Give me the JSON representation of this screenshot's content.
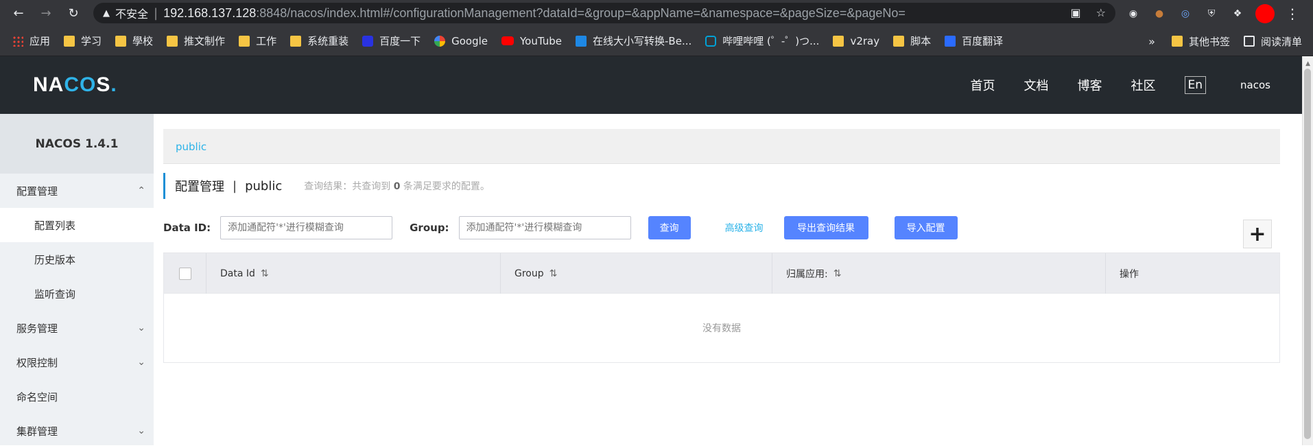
{
  "browser": {
    "security_label": "不安全",
    "url_host": "192.168.137.128",
    "url_path": ":8848/nacos/index.html#/configurationManagement?dataId=&group=&appName=&namespace=&pageSize=&pageNo=",
    "bookmarks": [
      {
        "label": "应用",
        "icon": "apps"
      },
      {
        "label": "学习",
        "icon": "folder"
      },
      {
        "label": "學校",
        "icon": "folder"
      },
      {
        "label": "推文制作",
        "icon": "folder"
      },
      {
        "label": "工作",
        "icon": "folder"
      },
      {
        "label": "系统重装",
        "icon": "folder"
      },
      {
        "label": "百度一下",
        "icon": "baidu"
      },
      {
        "label": "Google",
        "icon": "google"
      },
      {
        "label": "YouTube",
        "icon": "yt"
      },
      {
        "label": "在线大小写转换-Be...",
        "icon": "b"
      },
      {
        "label": "哔哩哔哩 (゜-゜)つ...",
        "icon": "bili"
      },
      {
        "label": "v2ray",
        "icon": "folder"
      },
      {
        "label": "脚本",
        "icon": "folder"
      },
      {
        "label": "百度翻译",
        "icon": "fanyi"
      }
    ],
    "other_bookmarks": "其他书签",
    "reading_list": "阅读清单",
    "more": "»"
  },
  "header": {
    "logo": "NACOS.",
    "nav": [
      "首页",
      "文档",
      "博客",
      "社区"
    ],
    "lang": "En",
    "user": "nacos"
  },
  "sidebar": {
    "title": "NACOS 1.4.1",
    "items": [
      {
        "label": "配置管理",
        "chevron": "up"
      },
      {
        "label": "配置列表",
        "sub": true,
        "active": true
      },
      {
        "label": "历史版本",
        "sub": true
      },
      {
        "label": "监听查询",
        "sub": true
      },
      {
        "label": "服务管理",
        "chevron": "down"
      },
      {
        "label": "权限控制",
        "chevron": "down"
      },
      {
        "label": "命名空间"
      },
      {
        "label": "集群管理",
        "chevron": "down"
      }
    ]
  },
  "main": {
    "namespace": "public",
    "title": "配置管理",
    "title_ns": "public",
    "result_prefix": "查询结果：共查询到",
    "result_count": "0",
    "result_suffix": "条满足要求的配置。",
    "dataid_label": "Data ID:",
    "dataid_placeholder": "添加通配符'*'进行模糊查询",
    "group_label": "Group:",
    "group_placeholder": "添加通配符'*'进行模糊查询",
    "query_btn": "查询",
    "advanced_link": "高级查询",
    "export_btn": "导出查询结果",
    "import_btn": "导入配置",
    "columns": [
      "Data Id",
      "Group",
      "归属应用:",
      "操作"
    ],
    "empty_text": "没有数据"
  }
}
